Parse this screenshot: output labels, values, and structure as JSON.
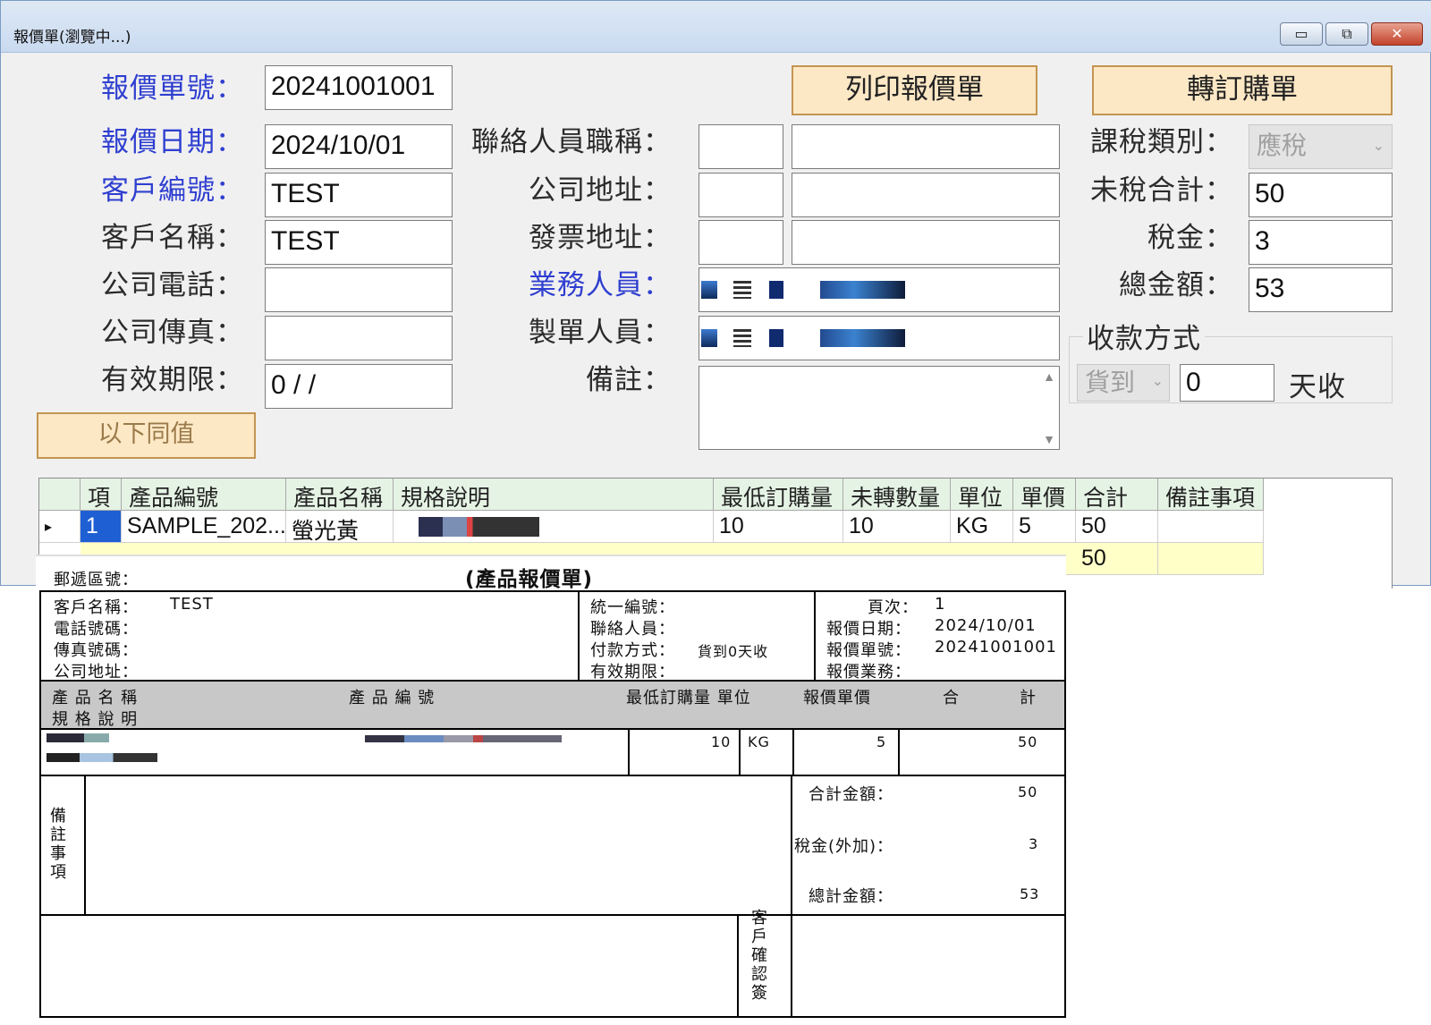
{
  "window": {
    "title": "報價單(瀏覽中...)",
    "min_glyph": "▭",
    "max_glyph": "⧉",
    "close_glyph": "✕"
  },
  "form": {
    "quote_no_label": "報價單號：",
    "quote_no": "20241001001",
    "quote_date_label": "報價日期：",
    "quote_date": "2024/10/01",
    "customer_no_label": "客戶編號：",
    "customer_no": "TEST",
    "customer_name_label": "客戶名稱：",
    "customer_name": "TEST",
    "company_phone_label": "公司電話：",
    "company_phone": "",
    "company_fax_label": "公司傳真：",
    "company_fax": "",
    "valid_until_label": "有效期限：",
    "valid_until": "0  / /",
    "same_below_button": "以下同值",
    "contact_title_label": "聯絡人員職稱：",
    "company_address_label": "公司地址：",
    "invoice_address_label": "發票地址：",
    "sales_person_label": "業務人員：",
    "creator_label": "製單人員：",
    "remarks_label": "備註：",
    "print_button": "列印報價單",
    "convert_button": "轉訂購單",
    "tax_type_label": "課稅類別：",
    "tax_type_value": "應稅",
    "untaxed_total_label": "未稅合計：",
    "untaxed_total": "50",
    "tax_label": "稅金：",
    "tax": "3",
    "grand_total_label": "總金額：",
    "grand_total": "53",
    "payment_method_label": "收款方式",
    "payment_method_value": "貨到",
    "payment_days": "0",
    "payment_days_suffix": "天收"
  },
  "grid": {
    "headers": [
      "項",
      "產品編號",
      "產品名稱",
      "規格說明",
      "最低訂購量",
      "未轉數量",
      "單位",
      "單價",
      "合計",
      "備註事項"
    ],
    "row_indicator": "▸",
    "rows": [
      {
        "item": "1",
        "product_no": "SAMPLE_202...",
        "product_name": "螢光黃",
        "min_order": "10",
        "unconverted": "10",
        "unit": "KG",
        "price": "5",
        "total": "50"
      }
    ],
    "summary_total": "50"
  },
  "report": {
    "postal_code_label": "郵遞區號：",
    "title": "(產品報價單)",
    "customer_name_label": "客戶名稱：",
    "customer_name": "TEST",
    "phone_label": "電話號碼：",
    "fax_label": "傳真號碼：",
    "address_label": "公司地址：",
    "tax_id_label": "統一編號：",
    "contact_label": "聯絡人員：",
    "payment_label": "付款方式：",
    "payment_value": "貨到0天收",
    "validity_label": "有效期限：",
    "page_label": "頁次：",
    "page_value": "1",
    "quote_date_label": "報價日期：",
    "quote_date": "2024/10/01",
    "quote_no_label": "報價單號：",
    "quote_no": "20241001001",
    "sales_label": "報價業務：",
    "col_product_name": "產 品 名 稱",
    "col_spec": "規 格 說 明",
    "col_product_no": "產 品 編 號",
    "col_min_unit": "最低訂購量  單位",
    "col_price": "報價單價",
    "col_total_1": "合",
    "col_total_2": "計",
    "line_min_order": "10",
    "line_unit": "KG",
    "line_price": "5",
    "line_total": "50",
    "remarks_label": "備\n註\n事\n項",
    "subtotal_label": "合計金額：",
    "subtotal": "50",
    "tax_label": "稅金(外加)：",
    "tax": "3",
    "total_label": "總計金額：",
    "total": "53",
    "signature_label": "客\n戶\n確\n認\n簽"
  },
  "colors": {
    "label_blue": "#2f3fd0",
    "button_fill": "#fde8c5",
    "grid_header": "#e5f3e5",
    "grid_summary": "#ffffc8",
    "report_header_gray": "#c8c8c8"
  }
}
